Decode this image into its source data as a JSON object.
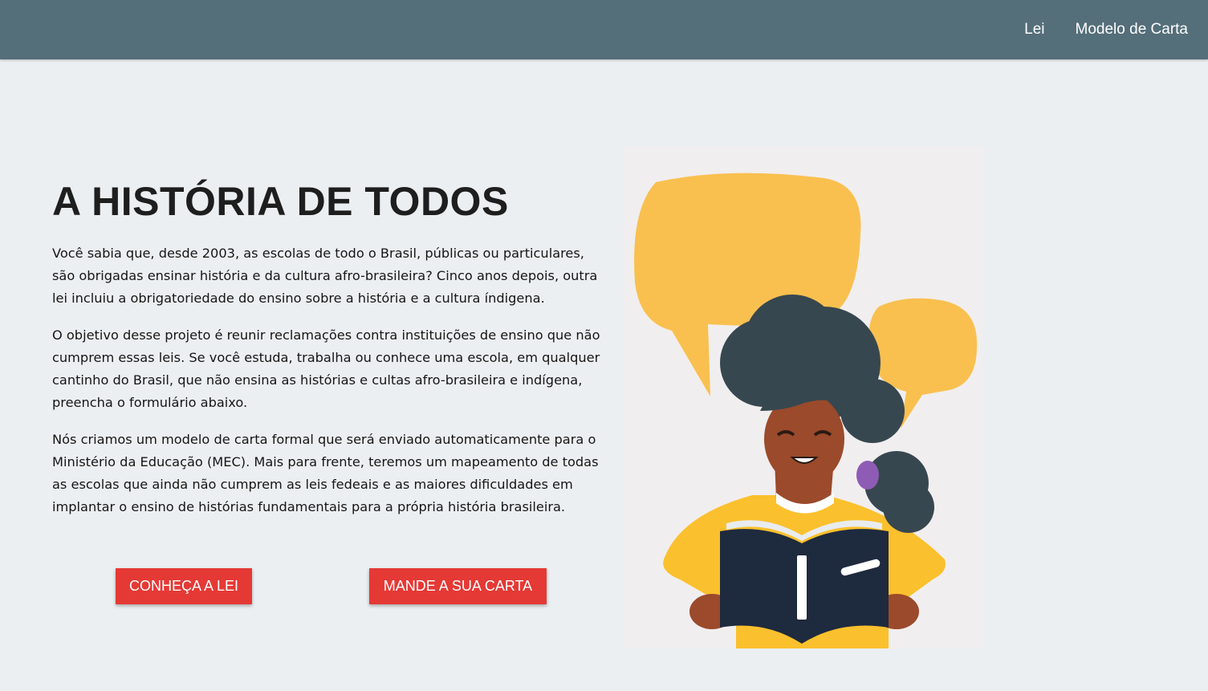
{
  "nav": {
    "links": [
      "Lei",
      "Modelo de Carta"
    ]
  },
  "hero": {
    "title": "A HISTÓRIA DE TODOS",
    "paragraphs": [
      "Você sabia que, desde 2003, as escolas de todo o Brasil, públicas ou particulares, são obrigadas ensinar história e da cultura afro-brasileira? Cinco anos depois, outra lei incluiu a obrigatoriedade do ensino sobre a história e a cultura índigena.",
      "O objetivo desse projeto é reunir reclamações contra instituições de ensino que não cumprem essas leis. Se você estuda, trabalha ou conhece uma escola, em qualquer cantinho do Brasil, que não ensina as histórias e cultas afro-brasileira e indígena, preencha o formulário abaixo.",
      "Nós criamos um modelo de carta formal que será enviado automaticamente para o Ministério da Educação (MEC). Mais para frente, teremos um mapeamento de todas as escolas que ainda não cumprem as leis fedeais e as maiores dificuldades em implantar o ensino de histórias fundamentais para a própria história brasileira."
    ],
    "buttons": {
      "lei": "CONHEÇA A LEI",
      "carta": "MANDE A SUA CARTA"
    }
  },
  "colors": {
    "navbar": "#546e7a",
    "background": "#eceff1",
    "button": "#e53935",
    "speech_bubble": "#f9c04f",
    "sweater": "#fbc02d",
    "book": "#1e2a3e"
  },
  "illustration": {
    "icon": "girl-reading-book-illustration"
  }
}
